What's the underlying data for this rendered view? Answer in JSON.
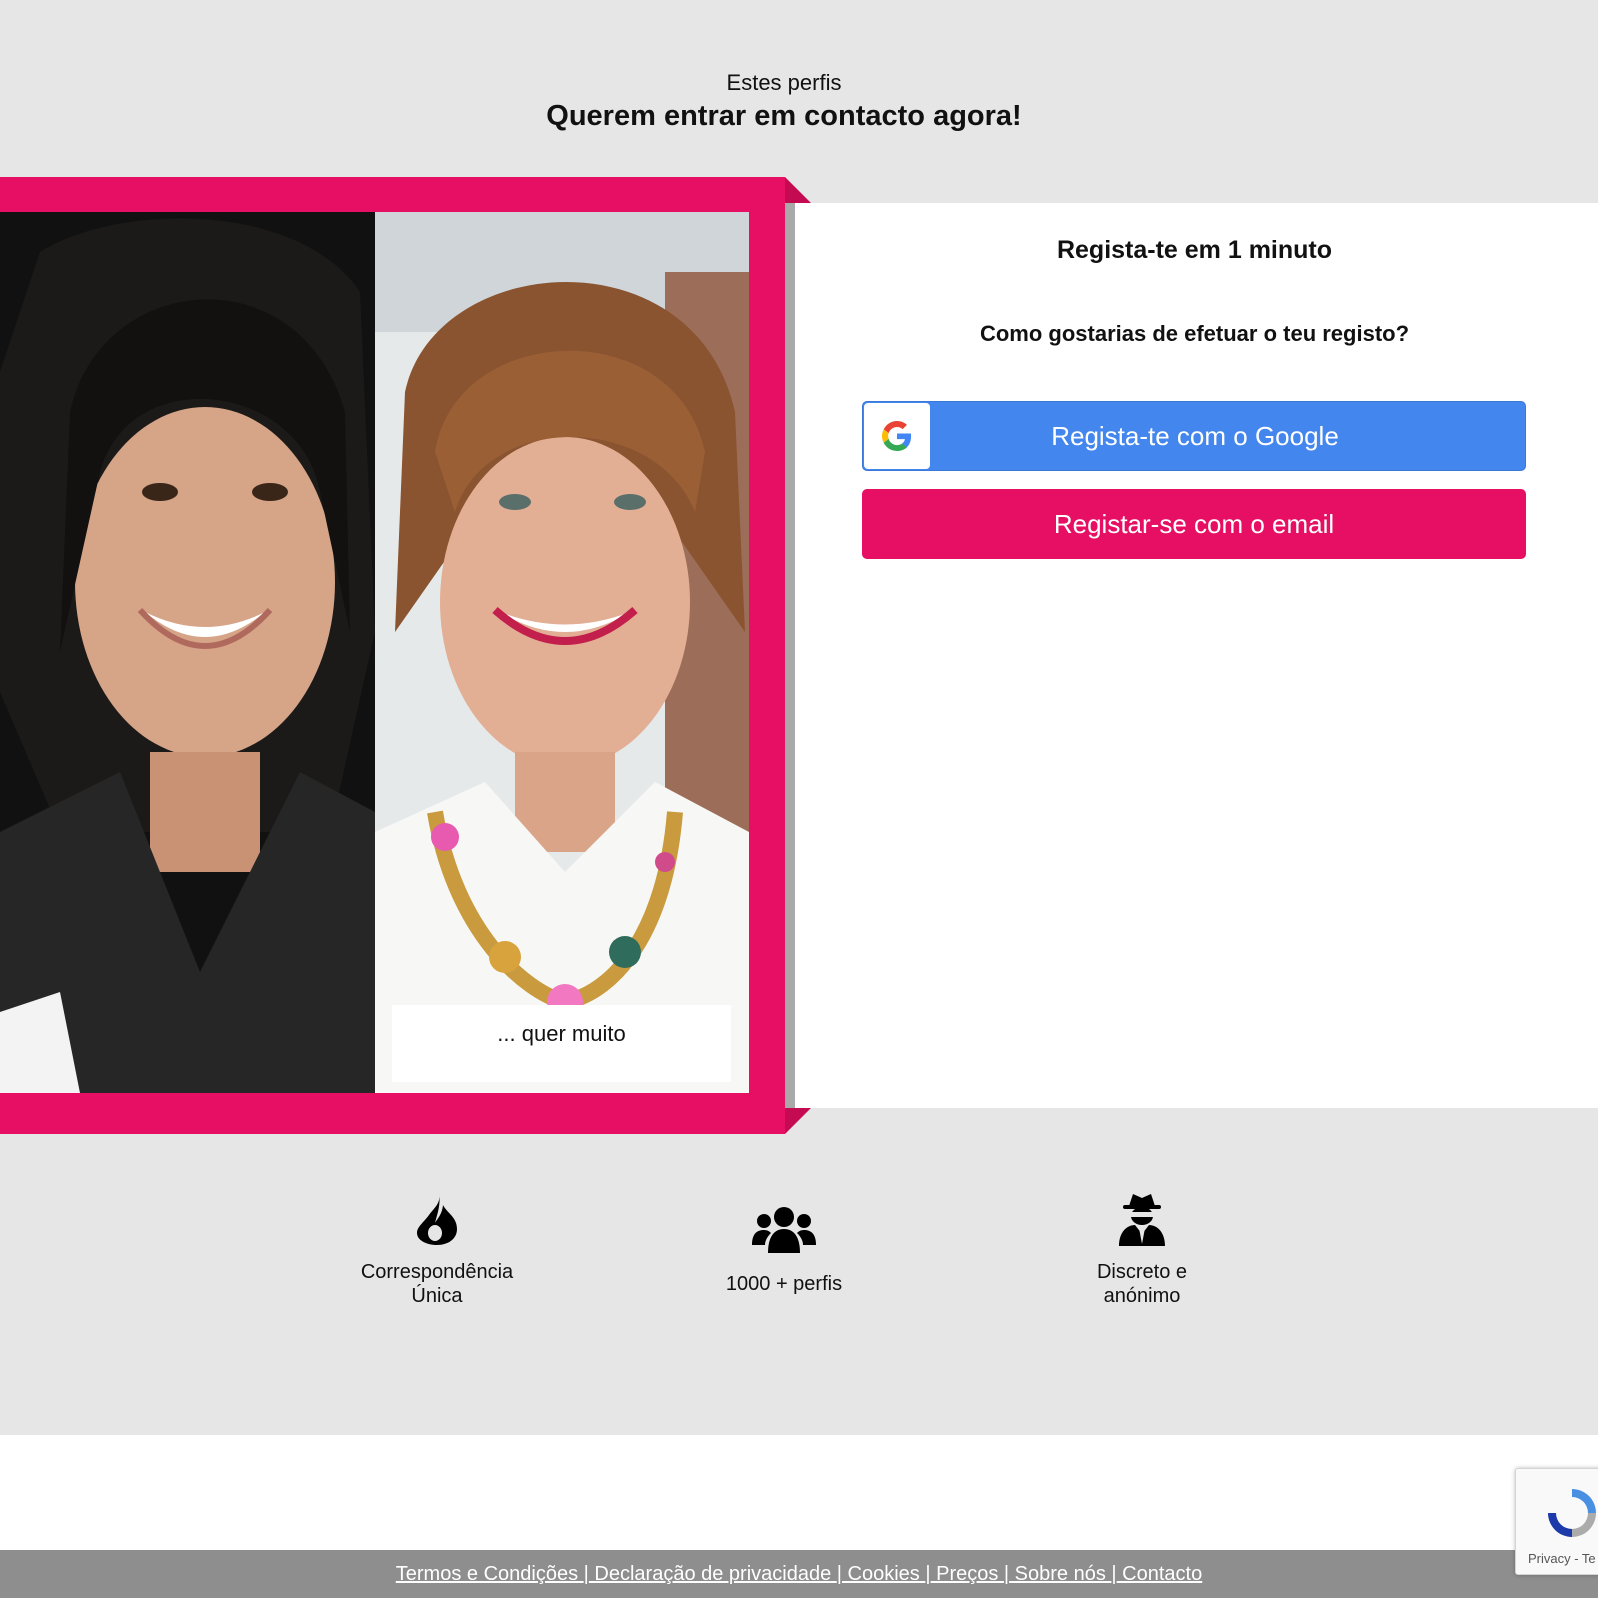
{
  "heading": {
    "sub": "Estes perfis",
    "main": "Querem entrar em contacto agora!"
  },
  "profiles": {
    "caption": "... quer muito"
  },
  "register": {
    "title": "Regista-te em 1 minuto",
    "question": "Como gostarias de efetuar o teu registo?",
    "google_label": "Regista-te com o Google",
    "email_label": "Registar-se com o email"
  },
  "features": [
    {
      "icon": "fire-icon",
      "line1": "Correspondência",
      "line2": "Única"
    },
    {
      "icon": "users-icon",
      "line1": "1000 + perfis"
    },
    {
      "icon": "user-secret-icon",
      "line1": "Discreto e",
      "line2": "anónimo"
    }
  ],
  "footer": {
    "links": [
      "Termos e Condições ",
      " Declaração de privacidade ",
      " Cookies ",
      " Preços ",
      " Sobre nós ",
      " Contacto"
    ],
    "separator": "|"
  },
  "recaptcha": {
    "text": "Privacy - Te"
  },
  "colors": {
    "brand_pink": "#e60f63",
    "google_blue": "#4386ee",
    "background": "#e6e6e6",
    "footer_gray": "#8e8e8e"
  }
}
